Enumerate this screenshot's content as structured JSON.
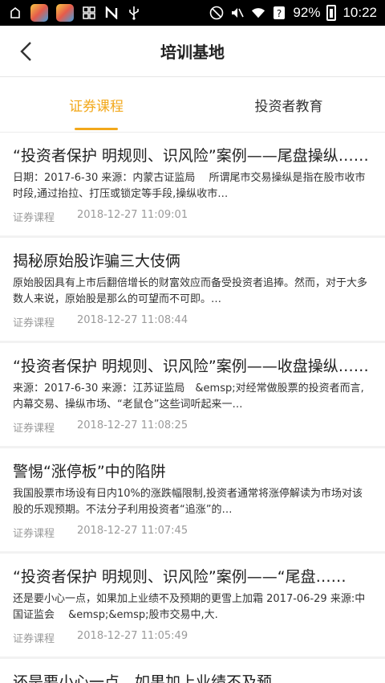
{
  "status_bar": {
    "battery_percent": "92%",
    "time": "10:22"
  },
  "header": {
    "title": "培训基地"
  },
  "tabs": [
    {
      "label": "证券课程",
      "active": true
    },
    {
      "label": "投资者教育",
      "active": false
    }
  ],
  "list": [
    {
      "title": "“投资者保护 明规则、识风险”案例——尾盘操纵……",
      "snippet": "日期：2017-6-30 来源：内蒙古证监局　 所谓尾市交易操纵是指在股市收市时段,通过抬拉、打压或锁定等手段,操纵收市…",
      "category": "证券课程",
      "datetime": "2018-12-27 11:09:01"
    },
    {
      "title": "揭秘原始股诈骗三大伎俩",
      "snippet": "原始股因具有上市后翻倍增长的财富效应而备受投资者追捧。然而，对于大多数人来说，原始股是那么的可望而不可即。…",
      "category": "证券课程",
      "datetime": "2018-12-27 11:08:44"
    },
    {
      "title": "“投资者保护 明规则、识风险”案例——收盘操纵……",
      "snippet": "来源：2017-6-30 来源：江苏证监局　&emsp;对经常做股票的投资者而言,内幕交易、操纵市场、“老鼠仓”这些词听起来一…",
      "category": "证券课程",
      "datetime": "2018-12-27 11:08:25"
    },
    {
      "title": "警惕“涨停板”中的陷阱",
      "snippet": "我国股票市场设有日内10%的涨跌幅限制,投资者通常将涨停解读为市场对该股的乐观预期。不法分子利用投资者“追涨”的…",
      "category": "证券课程",
      "datetime": "2018-12-27 11:07:45"
    },
    {
      "title": "“投资者保护 明规则、识风险”案例——“尾盘……",
      "snippet": "还是要小心一点，如果加上业绩不及预期的更雪上加霜 2017-06-29 来源:中国证监会　 &emsp;&emsp;股市交易中,大.",
      "category": "证券课程",
      "datetime": "2018-12-27 11:05:49"
    },
    {
      "title": "还是要小心一点，如果加上业绩不及预",
      "snippet": "",
      "category": "",
      "datetime": ""
    }
  ]
}
